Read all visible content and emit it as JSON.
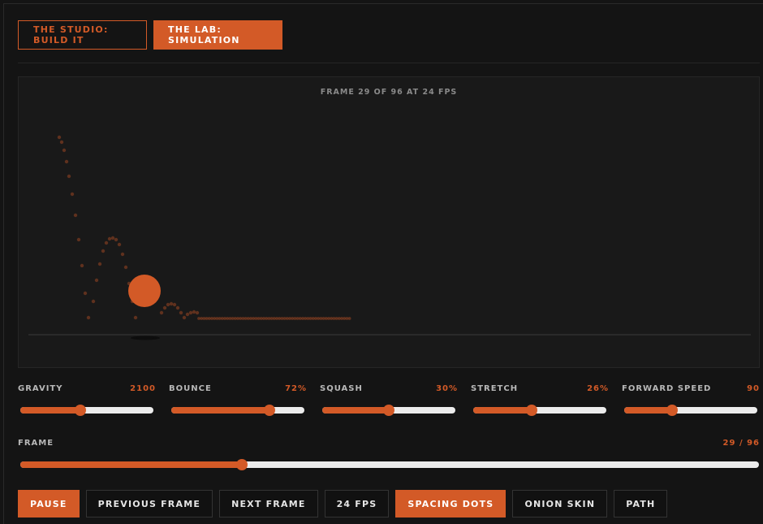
{
  "tabs": [
    {
      "label": "THE STUDIO: BUILD IT",
      "active": false
    },
    {
      "label": "THE LAB: SIMULATION",
      "active": true
    }
  ],
  "canvas": {
    "frame_label": "FRAME 29 OF 96 AT 24 FPS"
  },
  "sliders": [
    {
      "label": "GRAVITY",
      "value": "2100",
      "fraction": 0.45
    },
    {
      "label": "BOUNCE",
      "value": "72%",
      "fraction": 0.74
    },
    {
      "label": "SQUASH",
      "value": "30%",
      "fraction": 0.5
    },
    {
      "label": "STRETCH",
      "value": "26%",
      "fraction": 0.44
    },
    {
      "label": "FORWARD SPEED",
      "value": "90",
      "fraction": 0.36
    }
  ],
  "frame": {
    "label": "FRAME",
    "value": "29 / 96",
    "fraction": 0.3
  },
  "controls": [
    {
      "label": "PAUSE",
      "active": true
    },
    {
      "label": "PREVIOUS FRAME",
      "active": false
    },
    {
      "label": "NEXT FRAME",
      "active": false
    },
    {
      "label": "24 FPS",
      "active": false
    },
    {
      "label": "SPACING DOTS",
      "active": true
    },
    {
      "label": "ONION SKIN",
      "active": false
    },
    {
      "label": "PATH",
      "active": false
    }
  ],
  "colors": {
    "accent": "#d35a27",
    "background": "#141414",
    "canvas": "#191919"
  }
}
